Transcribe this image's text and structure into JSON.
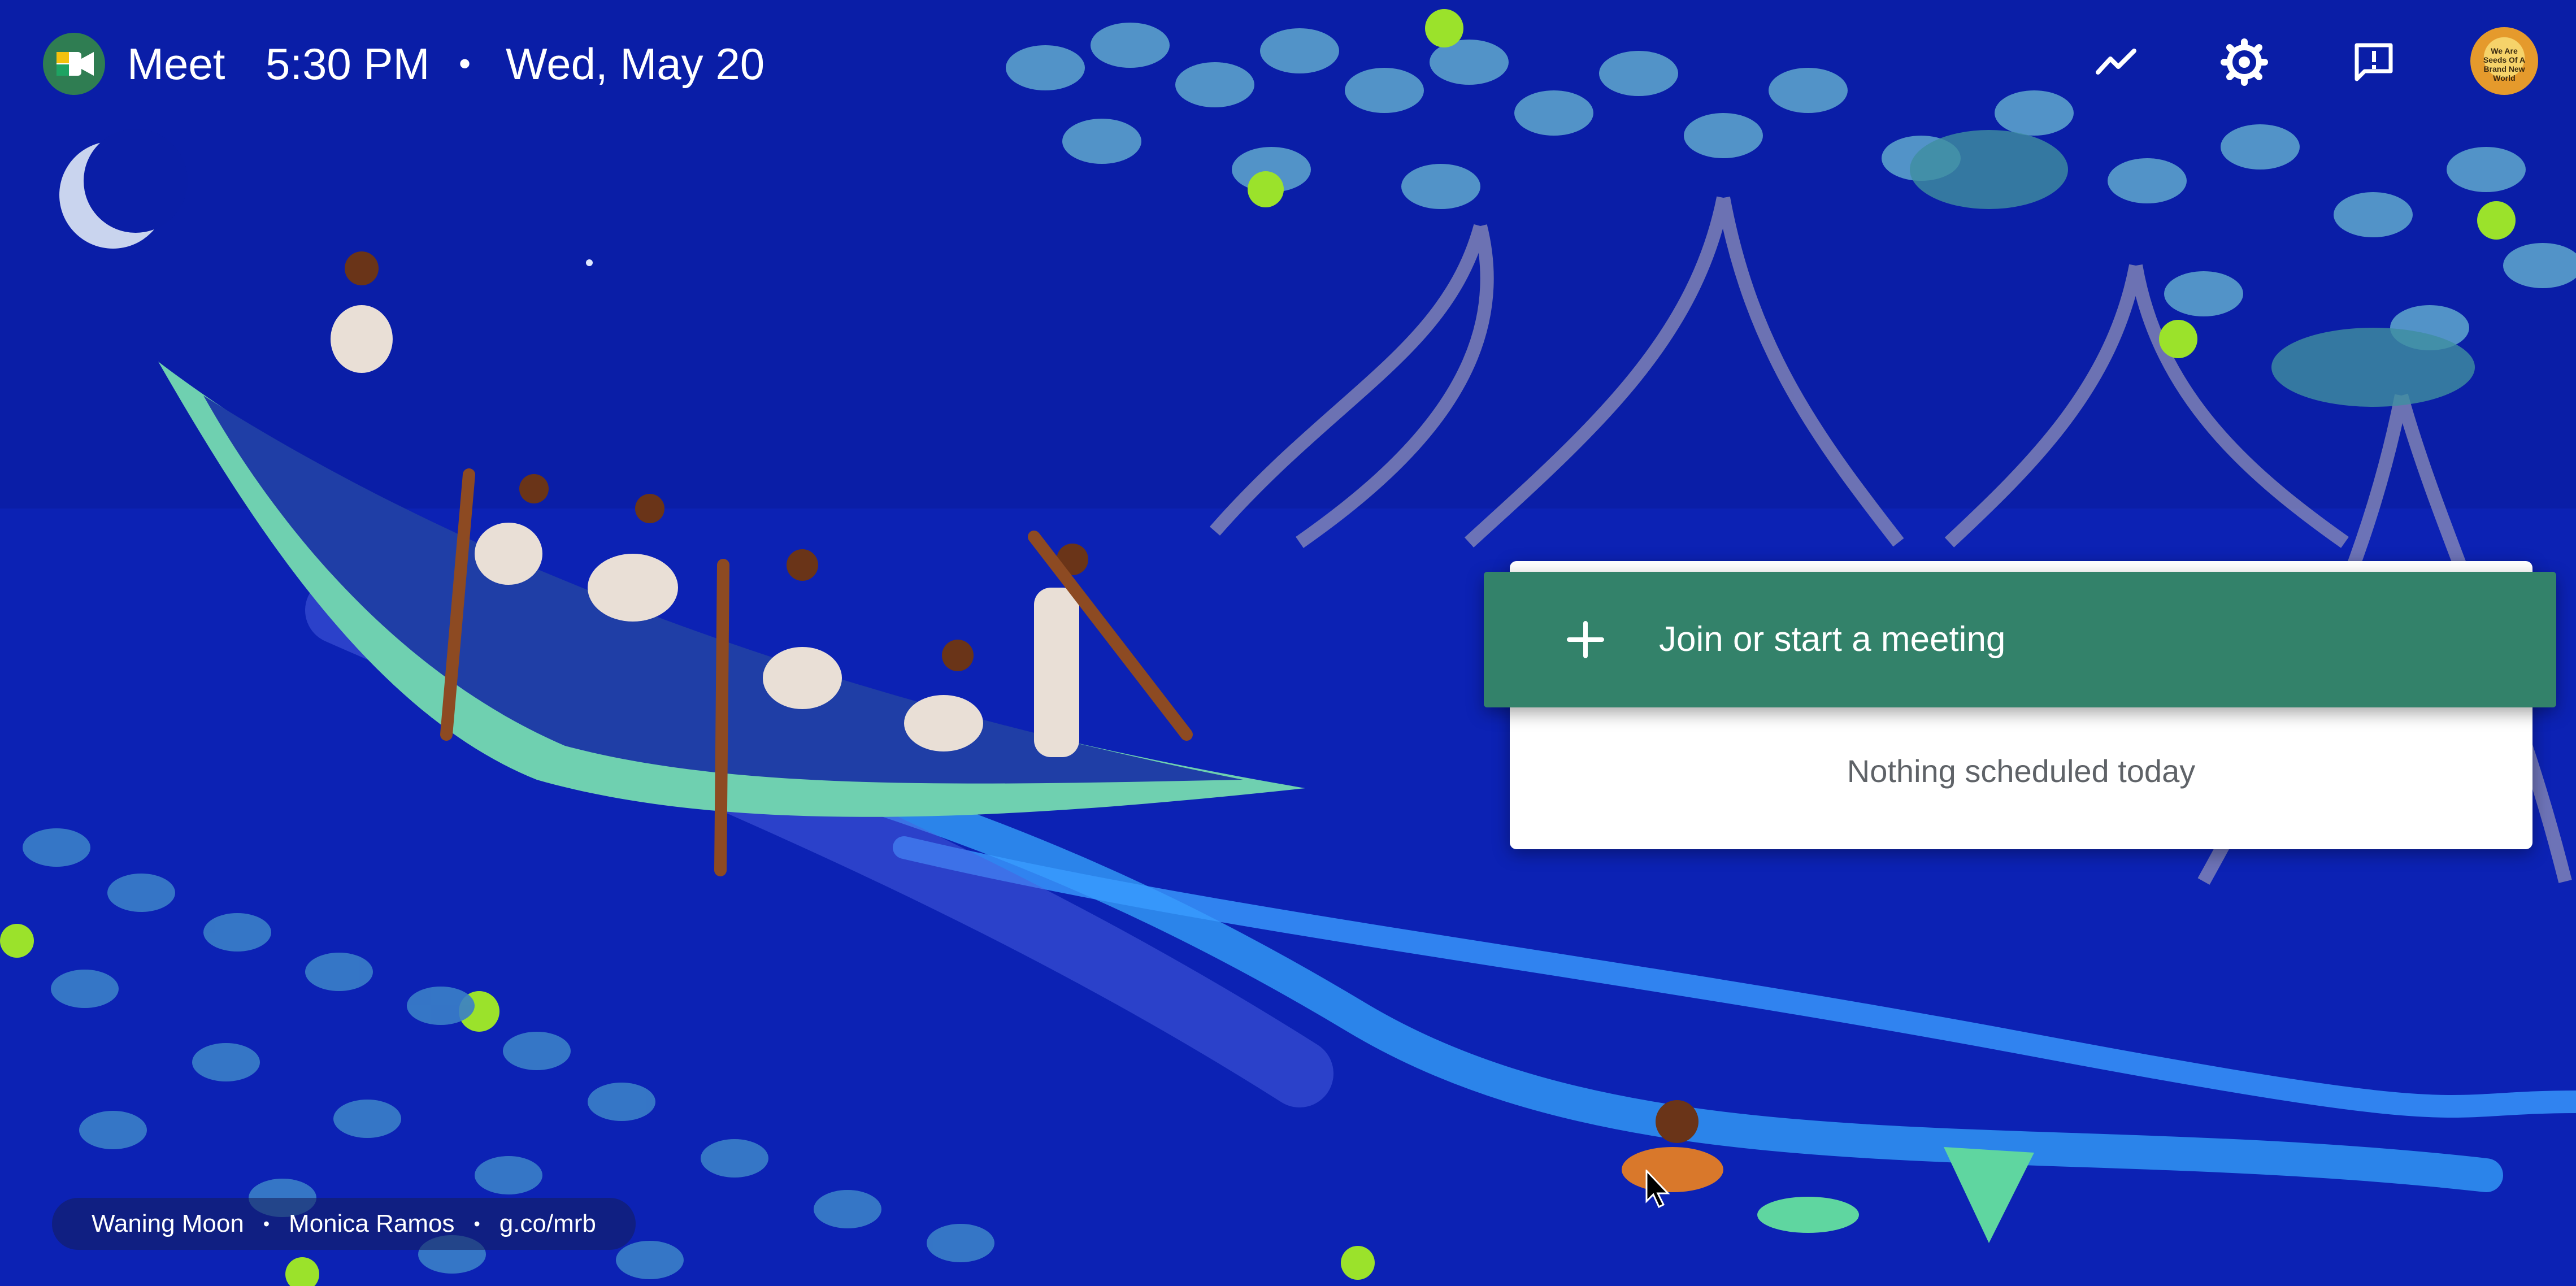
{
  "topbar": {
    "app_name": "Meet",
    "time": "5:30 PM",
    "separator": "•",
    "date": "Wed, May 20",
    "icons": [
      "activity-icon",
      "settings-gear-icon",
      "feedback-icon"
    ],
    "avatar_text": "We Are Seeds Of A Brand New World"
  },
  "meeting": {
    "join_label": "Join or start a meeting",
    "empty_text": "Nothing scheduled today"
  },
  "credit": {
    "title": "Waning Moon",
    "artist": "Monica Ramos",
    "link": "g.co/mrb",
    "separator": "•"
  },
  "colors": {
    "background": "#0b1fae",
    "join_button": "#33826a",
    "card": "#ffffff",
    "leaf": "#5fa0c8",
    "canoe": "#6fd0b0"
  }
}
